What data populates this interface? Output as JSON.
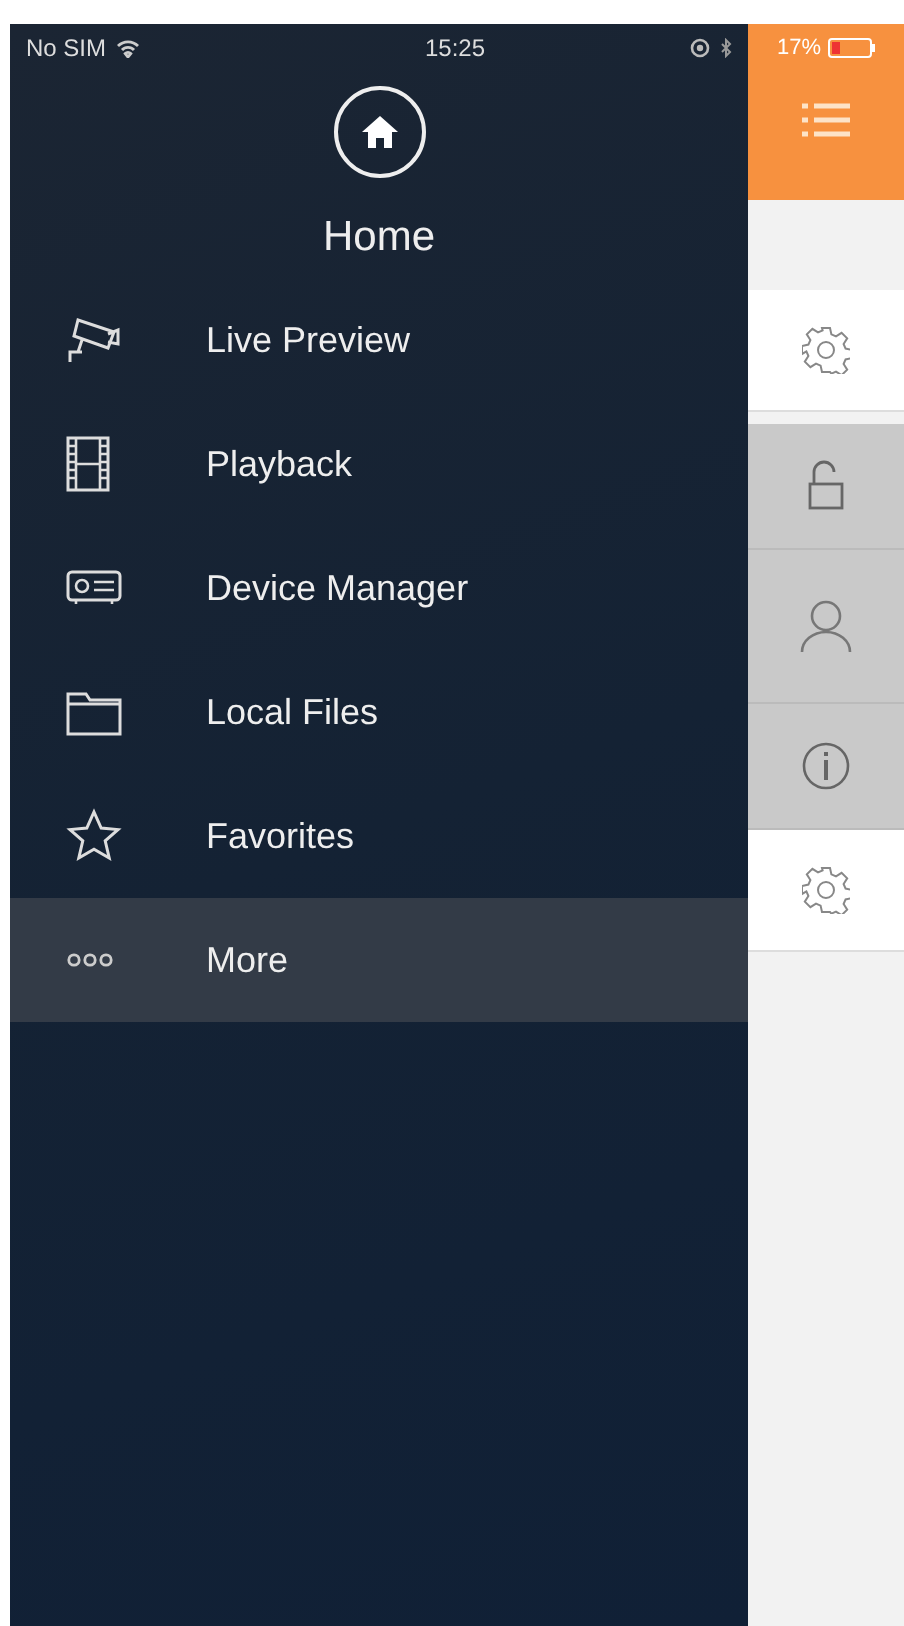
{
  "status_bar": {
    "carrier": "No SIM",
    "time": "15:25",
    "battery": "17%"
  },
  "drawer": {
    "header": {
      "title": "Home"
    },
    "items": [
      {
        "label": "Live Preview",
        "selected": false
      },
      {
        "label": "Playback",
        "selected": false
      },
      {
        "label": "Device Manager",
        "selected": false
      },
      {
        "label": "Local Files",
        "selected": false
      },
      {
        "label": "Favorites",
        "selected": false
      },
      {
        "label": "More",
        "selected": true
      }
    ]
  }
}
